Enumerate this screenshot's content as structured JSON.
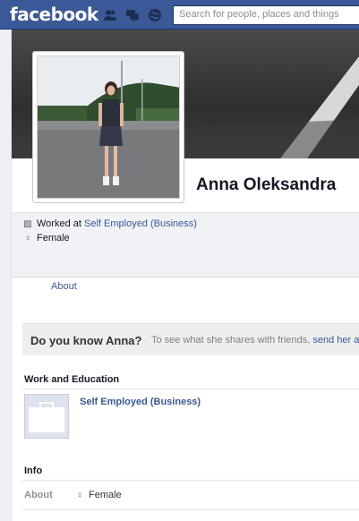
{
  "header": {
    "logo": "facebook",
    "search_placeholder": "Search for people, places and things",
    "jewels": [
      "friend-requests-icon",
      "messages-icon",
      "notifications-icon"
    ]
  },
  "profile": {
    "name": "Anna Oleksandra",
    "work_prefix": "Worked at",
    "work_place": "Self Employed (Business)",
    "gender": "Female"
  },
  "nav": {
    "about": "About"
  },
  "banner": {
    "question": "Do you know Anna?",
    "text": "To see what she shares with friends,",
    "link": "send her a"
  },
  "work_education": {
    "title": "Work and Education",
    "employer": "Self Employed (Business)"
  },
  "info": {
    "title": "Info",
    "label": "About",
    "gender": "Female"
  },
  "colors": {
    "brand_blue": "#3b5998",
    "link": "#3b5998"
  }
}
